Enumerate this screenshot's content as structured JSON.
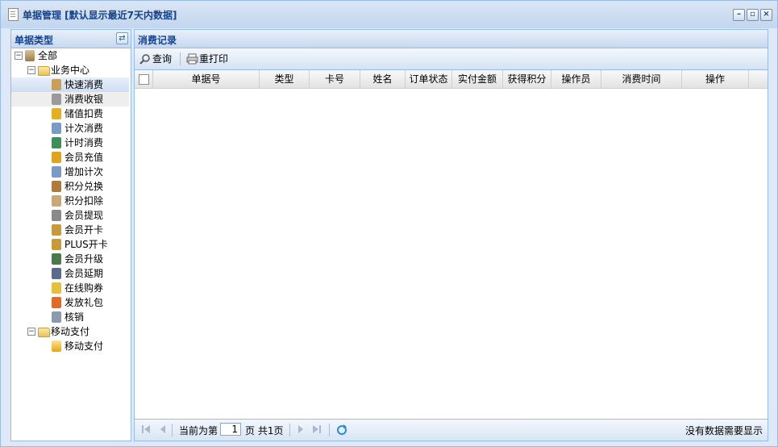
{
  "window": {
    "title": "单据管理 [默认显示最近7天内数据]"
  },
  "left_panel": {
    "title": "单据类型"
  },
  "tree": {
    "root": "全部",
    "business": "业务中心",
    "business_items": [
      "快速消费",
      "消费收银",
      "储值扣费",
      "计次消费",
      "计时消费",
      "会员充值",
      "增加计次",
      "积分兑换",
      "积分扣除",
      "会员提现",
      "会员开卡",
      "PLUS开卡",
      "会员升级",
      "会员延期",
      "在线购券",
      "发放礼包",
      "核销"
    ],
    "mobile": "移动支付",
    "mobile_items": [
      "移动支付"
    ]
  },
  "right_panel": {
    "title": "消费记录"
  },
  "toolbar": {
    "query": "查询",
    "reprint": "重打印"
  },
  "grid": {
    "columns": [
      "单据号",
      "类型",
      "卡号",
      "姓名",
      "订单状态",
      "实付金额",
      "获得积分",
      "操作员",
      "消费时间",
      "操作"
    ]
  },
  "pager": {
    "before": "当前为第",
    "page": "1",
    "after": "页 共1页",
    "empty_msg": "没有数据需要显示"
  }
}
